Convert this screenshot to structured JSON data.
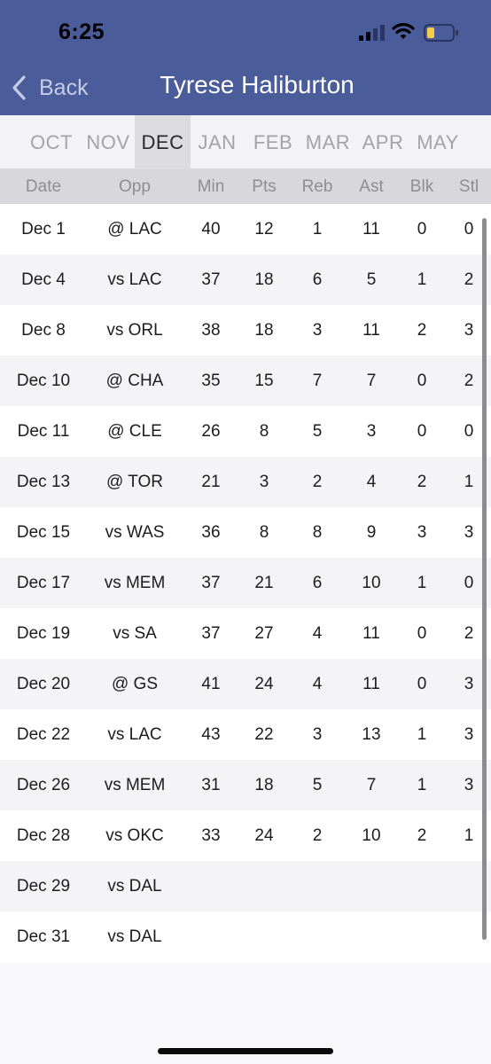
{
  "status_bar": {
    "time": "6:25"
  },
  "nav": {
    "back_label": "Back",
    "title": "Tyrese Haliburton"
  },
  "months": [
    {
      "label": "OCT",
      "active": false
    },
    {
      "label": "NOV",
      "active": false
    },
    {
      "label": "DEC",
      "active": true
    },
    {
      "label": "JAN",
      "active": false
    },
    {
      "label": "FEB",
      "active": false
    },
    {
      "label": "MAR",
      "active": false
    },
    {
      "label": "APR",
      "active": false
    },
    {
      "label": "MAY",
      "active": false
    }
  ],
  "columns": [
    "Date",
    "Opp",
    "Min",
    "Pts",
    "Reb",
    "Ast",
    "Blk",
    "Stl"
  ],
  "games": [
    [
      "Dec 1",
      "@ LAC",
      "40",
      "12",
      "1",
      "11",
      "0",
      "0"
    ],
    [
      "Dec 4",
      "vs LAC",
      "37",
      "18",
      "6",
      "5",
      "1",
      "2"
    ],
    [
      "Dec 8",
      "vs ORL",
      "38",
      "18",
      "3",
      "11",
      "2",
      "3"
    ],
    [
      "Dec 10",
      "@ CHA",
      "35",
      "15",
      "7",
      "7",
      "0",
      "2"
    ],
    [
      "Dec 11",
      "@ CLE",
      "26",
      "8",
      "5",
      "3",
      "0",
      "0"
    ],
    [
      "Dec 13",
      "@ TOR",
      "21",
      "3",
      "2",
      "4",
      "2",
      "1"
    ],
    [
      "Dec 15",
      "vs WAS",
      "36",
      "8",
      "8",
      "9",
      "3",
      "3"
    ],
    [
      "Dec 17",
      "vs MEM",
      "37",
      "21",
      "6",
      "10",
      "1",
      "0"
    ],
    [
      "Dec 19",
      "vs SA",
      "37",
      "27",
      "4",
      "11",
      "0",
      "2"
    ],
    [
      "Dec 20",
      "@ GS",
      "41",
      "24",
      "4",
      "11",
      "0",
      "3"
    ],
    [
      "Dec 22",
      "vs LAC",
      "43",
      "22",
      "3",
      "13",
      "1",
      "3"
    ],
    [
      "Dec 26",
      "vs MEM",
      "31",
      "18",
      "5",
      "7",
      "1",
      "3"
    ],
    [
      "Dec 28",
      "vs OKC",
      "33",
      "24",
      "2",
      "10",
      "2",
      "1"
    ],
    [
      "Dec 29",
      "vs DAL",
      "",
      "",
      "",
      "",
      "",
      ""
    ],
    [
      "Dec 31",
      "vs DAL",
      "",
      "",
      "",
      "",
      "",
      ""
    ]
  ],
  "colors": {
    "header": "#4a5c9a",
    "back": "#c5cce6",
    "active_month_bg": "#dcdcdf"
  },
  "icons": {
    "back": "chevron-left-icon",
    "signal": "cellular-signal-icon",
    "wifi": "wifi-icon",
    "battery": "battery-icon"
  }
}
